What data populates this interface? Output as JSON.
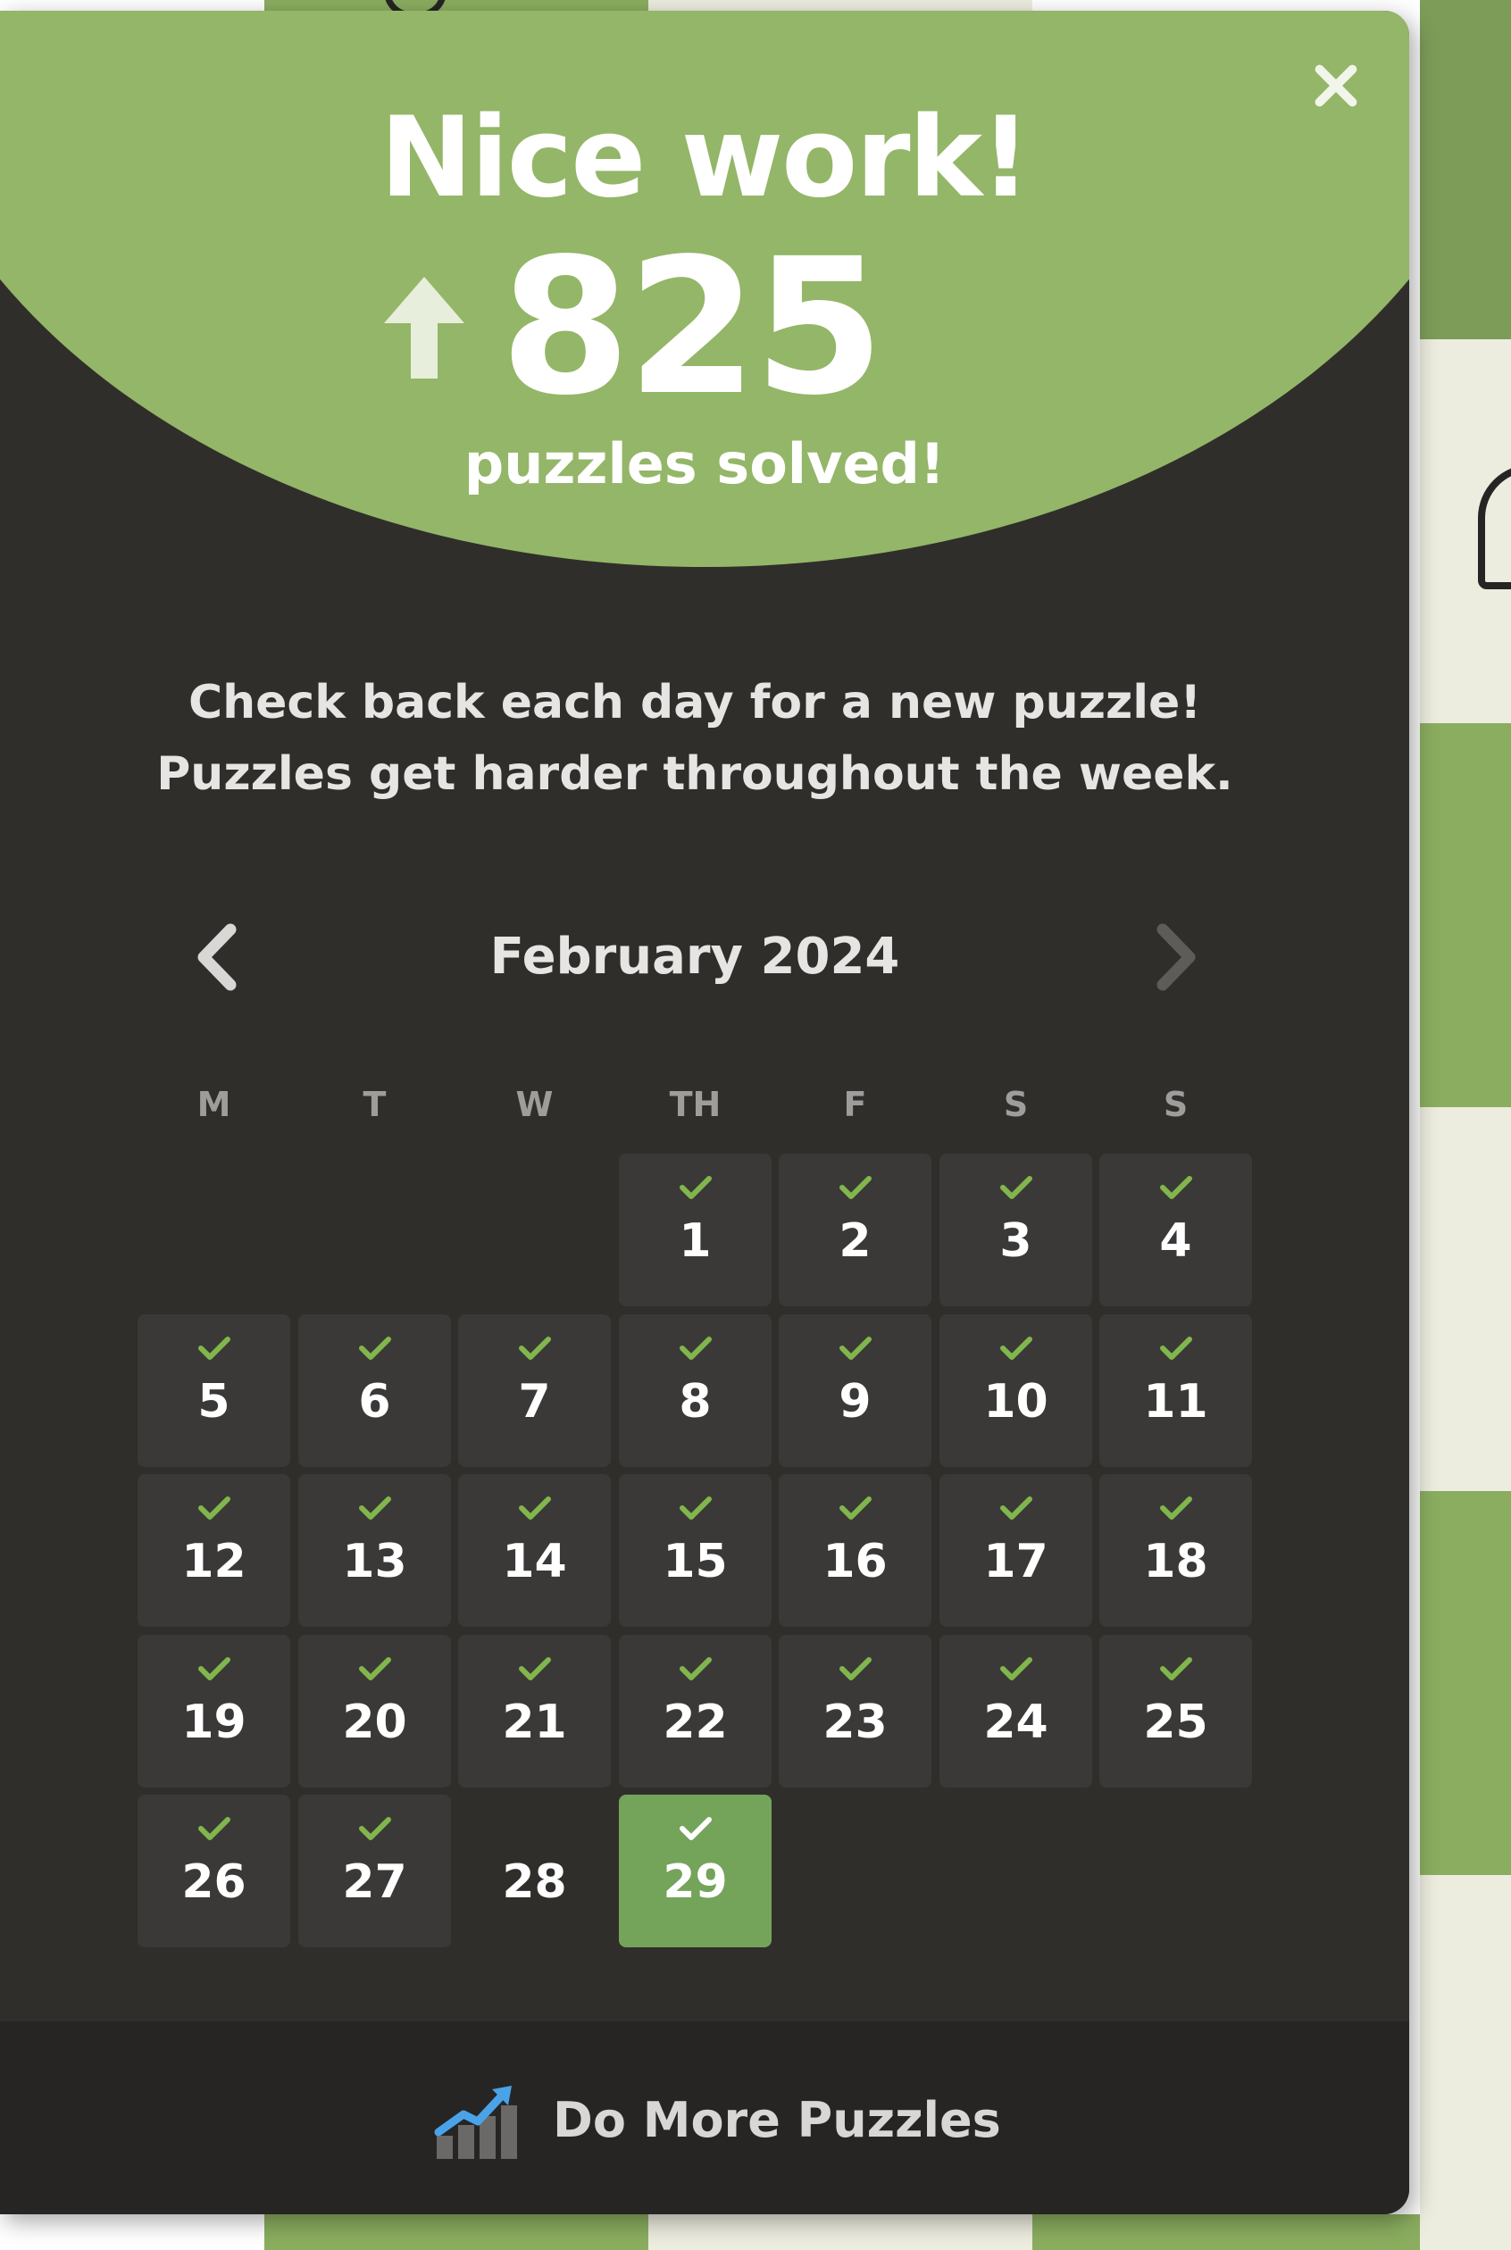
{
  "modal": {
    "title": "Nice work!",
    "solved_count": "825",
    "solved_label": "puzzles solved!",
    "info_line1": "Check back each day for a new puzzle!",
    "info_line2": "Puzzles get harder throughout the week.",
    "close_icon": "close-icon",
    "count_icon": "arrow-up-icon"
  },
  "calendar": {
    "month_label": "February 2024",
    "prev_icon": "chevron-left-icon",
    "next_icon": "chevron-right-icon",
    "weekdays": [
      "M",
      "T",
      "W",
      "TH",
      "F",
      "S",
      "S"
    ],
    "days": [
      {
        "num": "1",
        "solved": true
      },
      {
        "num": "2",
        "solved": true
      },
      {
        "num": "3",
        "solved": true
      },
      {
        "num": "4",
        "solved": true
      },
      {
        "num": "5",
        "solved": true
      },
      {
        "num": "6",
        "solved": true
      },
      {
        "num": "7",
        "solved": true
      },
      {
        "num": "8",
        "solved": true
      },
      {
        "num": "9",
        "solved": true
      },
      {
        "num": "10",
        "solved": true
      },
      {
        "num": "11",
        "solved": true
      },
      {
        "num": "12",
        "solved": true
      },
      {
        "num": "13",
        "solved": true
      },
      {
        "num": "14",
        "solved": true
      },
      {
        "num": "15",
        "solved": true
      },
      {
        "num": "16",
        "solved": true
      },
      {
        "num": "17",
        "solved": true
      },
      {
        "num": "18",
        "solved": true
      },
      {
        "num": "19",
        "solved": true
      },
      {
        "num": "20",
        "solved": true
      },
      {
        "num": "21",
        "solved": true
      },
      {
        "num": "22",
        "solved": true
      },
      {
        "num": "23",
        "solved": true
      },
      {
        "num": "24",
        "solved": true
      },
      {
        "num": "25",
        "solved": true
      },
      {
        "num": "26",
        "solved": true
      },
      {
        "num": "27",
        "solved": true
      },
      {
        "num": "28",
        "solved": false
      },
      {
        "num": "29",
        "solved": true,
        "today": true
      }
    ]
  },
  "footer": {
    "button_label": "Do More Puzzles",
    "icon": "chart-icon"
  },
  "colors": {
    "accent_green": "#94b668",
    "today_green": "#74a35a",
    "check_green": "#81b64c",
    "panel_bg": "#302e2b",
    "cell_bg": "#3a3937",
    "footer_bg": "#262523"
  }
}
